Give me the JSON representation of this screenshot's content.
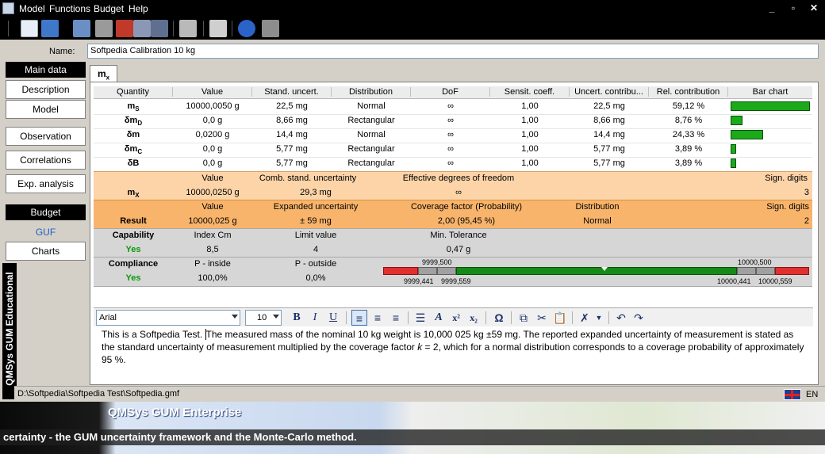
{
  "menu": [
    "Model",
    "Functions",
    "Budget",
    "Help"
  ],
  "name_label": "Name:",
  "name_value": "Softpedia Calibration 10 kg",
  "tab_label": "mx",
  "nav": {
    "main_data": "Main data",
    "description": "Description",
    "model": "Model",
    "observation": "Observation",
    "correlations": "Correlations",
    "exp_analysis": "Exp. analysis",
    "budget": "Budget",
    "guf": "GUF",
    "charts": "Charts"
  },
  "vertical_caption": "QMSys GUM Educational",
  "table": {
    "headers": [
      "Quantity",
      "Value",
      "Stand. uncert.",
      "Distribution",
      "DoF",
      "Sensit. coeff.",
      "Uncert. contribu...",
      "Rel. contribution",
      "Bar chart"
    ],
    "rows": [
      {
        "q": "mS",
        "value": "10000,0050 g",
        "su": "22,5 mg",
        "dist": "Normal",
        "dof": "∞",
        "sc": "1,00",
        "uc": "22,5 mg",
        "rel": "59,12 %",
        "pct": 59.12
      },
      {
        "q": "δmD",
        "value": "0,0 g",
        "su": "8,66 mg",
        "dist": "Rectangular",
        "dof": "∞",
        "sc": "1,00",
        "uc": "8,66 mg",
        "rel": "8,76 %",
        "pct": 8.76
      },
      {
        "q": "δm",
        "value": "0,0200 g",
        "su": "14,4 mg",
        "dist": "Normal",
        "dof": "∞",
        "sc": "1,00",
        "uc": "14,4 mg",
        "rel": "24,33 %",
        "pct": 24.33
      },
      {
        "q": "δmC",
        "value": "0,0 g",
        "su": "5,77 mg",
        "dist": "Rectangular",
        "dof": "∞",
        "sc": "1,00",
        "uc": "5,77 mg",
        "rel": "3,89 %",
        "pct": 3.89
      },
      {
        "q": "δB",
        "value": "0,0 g",
        "su": "5,77 mg",
        "dist": "Rectangular",
        "dof": "∞",
        "sc": "1,00",
        "uc": "5,77 mg",
        "rel": "3,89 %",
        "pct": 3.89
      }
    ]
  },
  "combined": {
    "value_h": "Value",
    "csu_h": "Comb. stand. uncertainty",
    "edf_h": "Effective degrees of freedom",
    "sig_h": "Sign. digits",
    "name": "mX",
    "value": "10000,0250 g",
    "csu": "29,3 mg",
    "edf": "∞",
    "sig": "3"
  },
  "result": {
    "value_h": "Value",
    "eu_h": "Expanded uncertainty",
    "cf_h": "Coverage factor (Probability)",
    "dist_h": "Distribution",
    "sig_h": "Sign. digits",
    "label": "Result",
    "value": "10000,025 g",
    "eu": "± 59 mg",
    "cf": "2,00 (95,45 %)",
    "dist": "Normal",
    "sig": "2"
  },
  "capability": {
    "label": "Capability",
    "ic_h": "Index Cm",
    "lv_h": "Limit value",
    "mt_h": "Min. Tolerance",
    "status": "Yes",
    "ic": "8,5",
    "lv": "4",
    "mt": "0,47 g"
  },
  "compliance": {
    "label": "Compliance",
    "pi_h": "P - inside",
    "po_h": "P - outside",
    "status": "Yes",
    "pi": "100,0%",
    "po": "0,0%",
    "scale_top_left": "9999,500",
    "scale_top_right": "10000,500",
    "scale_bot_1": "9999,441",
    "scale_bot_2": "9999,559",
    "scale_bot_3": "10000,441",
    "scale_bot_4": "10000,559"
  },
  "editor": {
    "font": "Arial",
    "size": "10",
    "text_1": "This is a Softpedia Test. ",
    "text_2": "The measured mass of the nominal 10 kg weight is 10,000 025 kg ±59 mg. The reported expanded uncertainty of measurement is stated as the standard uncertainty of measurement multiplied by the coverage factor ",
    "text_k": "k",
    "text_3": " = 2, which for a normal distribution corresponds to a coverage probability of approximately 95 %."
  },
  "status": {
    "path": "D:\\Softpedia\\Softpedia Test\\Softpedia.gmf",
    "lang": "EN"
  },
  "banner": {
    "title": "QMSys GUM Enterprise",
    "ticker": "certainty - the GUM uncertainty framework and the Monte-Carlo method."
  },
  "colors": {
    "bar_green": "#1aaa1a",
    "combined_bg": "#fcd4a8",
    "result_bg": "#f9b46b",
    "gray_zone": "#d6d6d6",
    "status_green": "#0a9a0a"
  }
}
